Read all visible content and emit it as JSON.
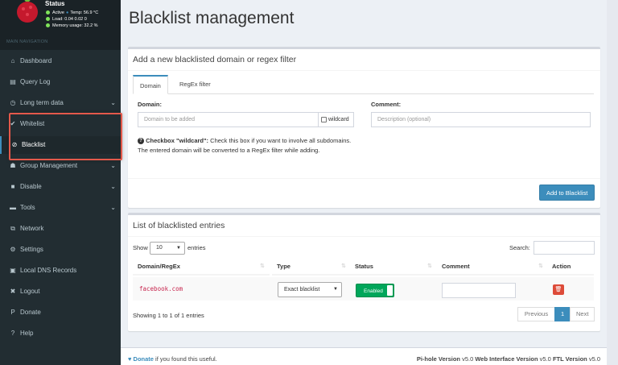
{
  "sidebar": {
    "status": {
      "title": "Status",
      "active": "Active",
      "temp": "Temp: 56.9 °C",
      "load": "Load:  0.04  0.02  0",
      "memory": "Memory usage:  32.2 %"
    },
    "nav_header": "MAIN NAVIGATION",
    "items": [
      {
        "label": "Dashboard",
        "icon": "home-icon"
      },
      {
        "label": "Query Log",
        "icon": "file-icon"
      },
      {
        "label": "Long term data",
        "icon": "clock-icon"
      },
      {
        "label": "Whitelist",
        "icon": "check-circle-icon"
      },
      {
        "label": "Blacklist",
        "icon": "ban-icon"
      },
      {
        "label": "Group Management",
        "icon": "users-icon"
      },
      {
        "label": "Disable",
        "icon": "stop-icon"
      },
      {
        "label": "Tools",
        "icon": "folder-icon"
      },
      {
        "label": "Network",
        "icon": "network-icon"
      },
      {
        "label": "Settings",
        "icon": "cogs-icon"
      },
      {
        "label": "Local DNS Records",
        "icon": "address-book-icon"
      },
      {
        "label": "Logout",
        "icon": "user-times-icon"
      },
      {
        "label": "Donate",
        "icon": "paypal-icon"
      },
      {
        "label": "Help",
        "icon": "question-circle-icon"
      }
    ]
  },
  "page": {
    "title": "Blacklist management"
  },
  "add_box": {
    "title": "Add a new blacklisted domain or regex filter",
    "tabs": [
      "Domain",
      "RegEx filter"
    ],
    "domain_label": "Domain:",
    "domain_placeholder": "Domain to be added",
    "wildcard_label": "wildcard",
    "comment_label": "Comment:",
    "comment_placeholder": "Description (optional)",
    "help_bold": "Checkbox \"wildcard\":",
    "help_text": " Check this box if you want to involve all subdomains. The entered domain will be converted to a RegEx filter while adding.",
    "add_button": "Add to Blacklist"
  },
  "list_box": {
    "title": "List of blacklisted entries",
    "show_label": "Show",
    "show_value": "10",
    "entries_label": "entries",
    "search_label": "Search:",
    "columns": [
      "Domain/RegEx",
      "Type",
      "Status",
      "Comment",
      "Action"
    ],
    "rows": [
      {
        "domain": "facebook.com",
        "type": "Exact blacklist",
        "status": "Enabled",
        "comment": ""
      }
    ],
    "info": "Showing 1 to 1 of 1 entries",
    "pagination": {
      "previous": "Previous",
      "page": "1",
      "next": "Next"
    }
  },
  "footer": {
    "donate": "Donate",
    "donate_suffix": " if you found this useful.",
    "pihole_label": "Pi-hole Version",
    "pihole_version": " v5.0 ",
    "web_label": "Web Interface Version",
    "web_version": " v5.0 ",
    "ftl_label": "FTL Version",
    "ftl_version": " v5.0"
  },
  "colors": {
    "accent": "#3c8dbc",
    "sidebar": "#222d32",
    "highlight": "#e4594b",
    "success": "#00a65a",
    "danger": "#dd4b39"
  }
}
